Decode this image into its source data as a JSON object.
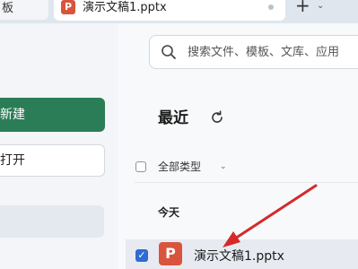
{
  "tabs": [
    {
      "label": "板"
    },
    {
      "label": "演示文稿1.pptx",
      "file_badge": "P"
    }
  ],
  "topbar": {
    "new_tab_symbol": "+",
    "dropdown_symbol": "⌄"
  },
  "search": {
    "placeholder": "搜索文件、模板、文库、应用"
  },
  "sidebar": {
    "new_label": "新建",
    "open_label": "打开"
  },
  "main": {
    "section_title": "最近",
    "refresh_icon": "refresh-icon",
    "filter_label": "全部类型",
    "group_label": "今天",
    "files": [
      {
        "name": "演示文稿1.pptx",
        "badge": "P",
        "selected": true
      }
    ]
  },
  "colors": {
    "accent_green": "#2b7d57",
    "ppt_red": "#d9543c",
    "checkbox_blue": "#2e6cd3",
    "annotation_arrow": "#d42a2a"
  }
}
